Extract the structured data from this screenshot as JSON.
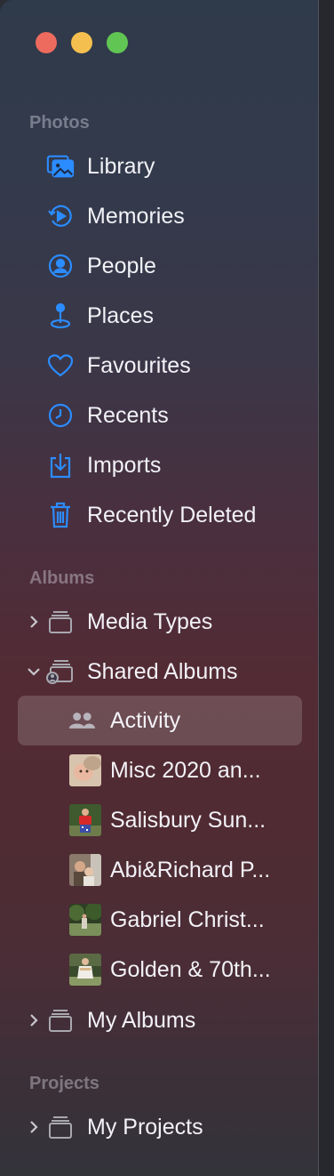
{
  "window": {
    "controls": [
      "close",
      "minimize",
      "maximize"
    ],
    "colors": {
      "close": "#ed6a5e",
      "minimize": "#f5bf4f",
      "maximize": "#61c554",
      "accent": "#2b8cff"
    }
  },
  "sidebar": {
    "photos_header": "Photos",
    "photos_items": [
      {
        "label": "Library",
        "icon": "library-icon"
      },
      {
        "label": "Memories",
        "icon": "memories-icon"
      },
      {
        "label": "People",
        "icon": "people-icon"
      },
      {
        "label": "Places",
        "icon": "places-icon"
      },
      {
        "label": "Favourites",
        "icon": "heart-icon"
      },
      {
        "label": "Recents",
        "icon": "clock-icon"
      },
      {
        "label": "Imports",
        "icon": "import-icon"
      },
      {
        "label": "Recently Deleted",
        "icon": "trash-icon"
      }
    ],
    "albums_header": "Albums",
    "media_types": {
      "label": "Media Types",
      "expanded": false
    },
    "shared_albums": {
      "label": "Shared Albums",
      "expanded": true,
      "activity": {
        "label": "Activity",
        "selected": true
      },
      "albums": [
        {
          "label": "Misc 2020 an..."
        },
        {
          "label": "Salisbury Sun..."
        },
        {
          "label": "Abi&Richard P..."
        },
        {
          "label": "Gabriel Christ..."
        },
        {
          "label": "Golden & 70th..."
        }
      ]
    },
    "my_albums": {
      "label": "My Albums",
      "expanded": false
    },
    "projects_header": "Projects",
    "my_projects": {
      "label": "My Projects",
      "expanded": false
    }
  }
}
